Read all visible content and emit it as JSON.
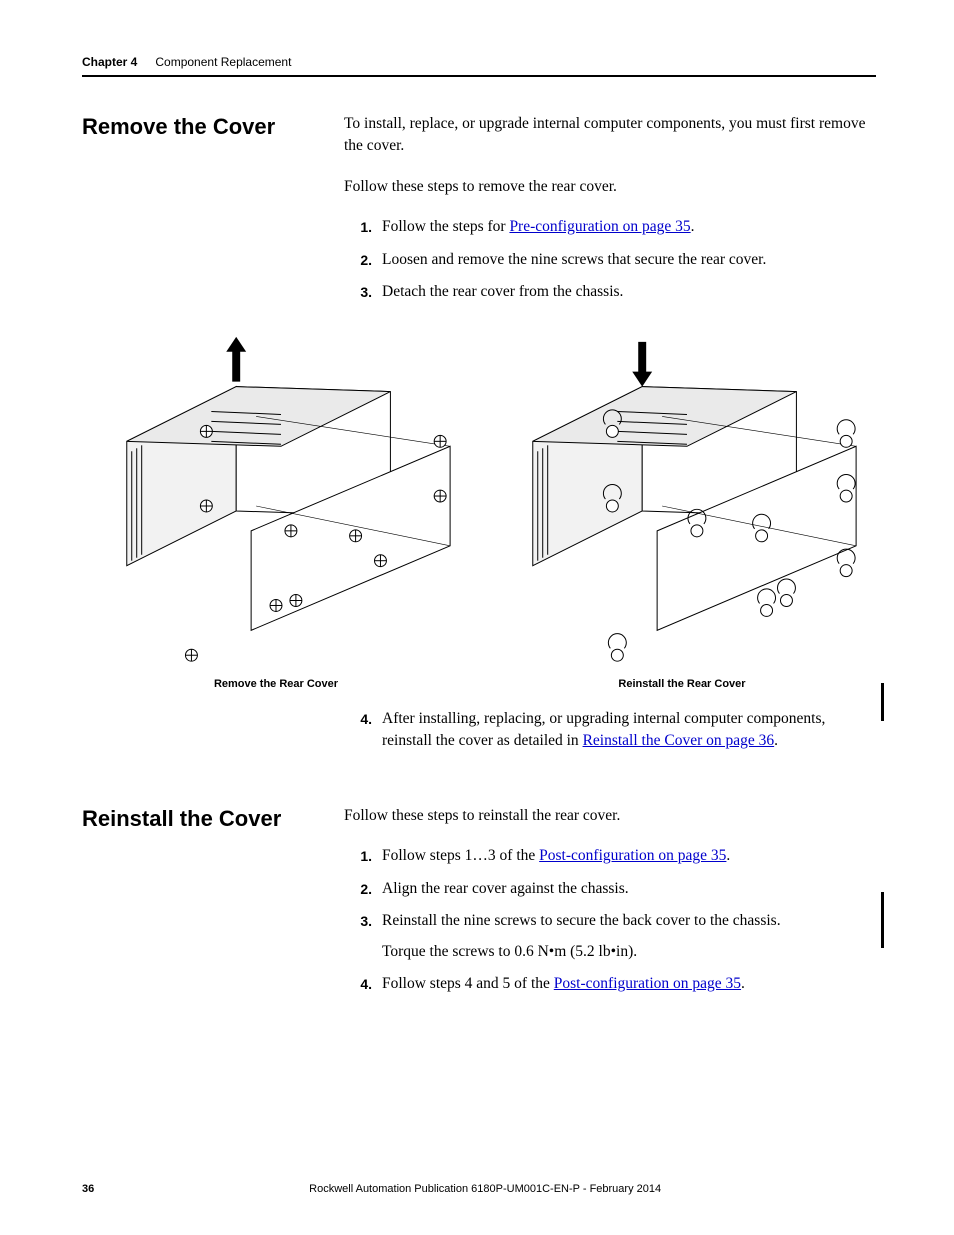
{
  "header": {
    "chapter_label": "Chapter 4",
    "chapter_title": "Component Replacement"
  },
  "section1": {
    "heading": "Remove the Cover",
    "intro": "To install, replace, or upgrade internal computer components, you must first remove the cover.",
    "lead": "Follow these steps to remove the rear cover.",
    "steps": [
      {
        "num": "1.",
        "pre": "Follow the steps for ",
        "link": "Pre-configuration on page 35",
        "post": "."
      },
      {
        "num": "2.",
        "text": "Loosen and remove the nine screws that secure the rear cover."
      },
      {
        "num": "3.",
        "text": "Detach the rear cover from the chassis."
      }
    ],
    "step4": {
      "num": "4.",
      "pre": "After installing, replacing, or upgrading internal computer components, reinstall the cover as detailed in ",
      "link": "Reinstall the Cover on page 36",
      "post": "."
    }
  },
  "figures": {
    "left_caption": "Remove the Rear Cover",
    "right_caption": "Reinstall the Rear Cover"
  },
  "section2": {
    "heading": "Reinstall the Cover",
    "lead": "Follow these steps to reinstall the rear cover.",
    "steps": [
      {
        "num": "1.",
        "pre": "Follow steps 1…3 of the ",
        "link": "Post-configuration on page 35",
        "post": "."
      },
      {
        "num": "2.",
        "text": "Align the rear cover against the chassis."
      },
      {
        "num": "3.",
        "text": "Reinstall the nine screws to secure the back cover to the chassis.",
        "sub": "Torque the screws to 0.6 N•m (5.2 lb•in)."
      },
      {
        "num": "4.",
        "pre": "Follow steps 4 and 5 of the ",
        "link": "Post-configuration on page 35",
        "post": "."
      }
    ]
  },
  "footer": {
    "page": "36",
    "publication": "Rockwell Automation Publication 6180P-UM001C-EN-P - February 2014"
  }
}
